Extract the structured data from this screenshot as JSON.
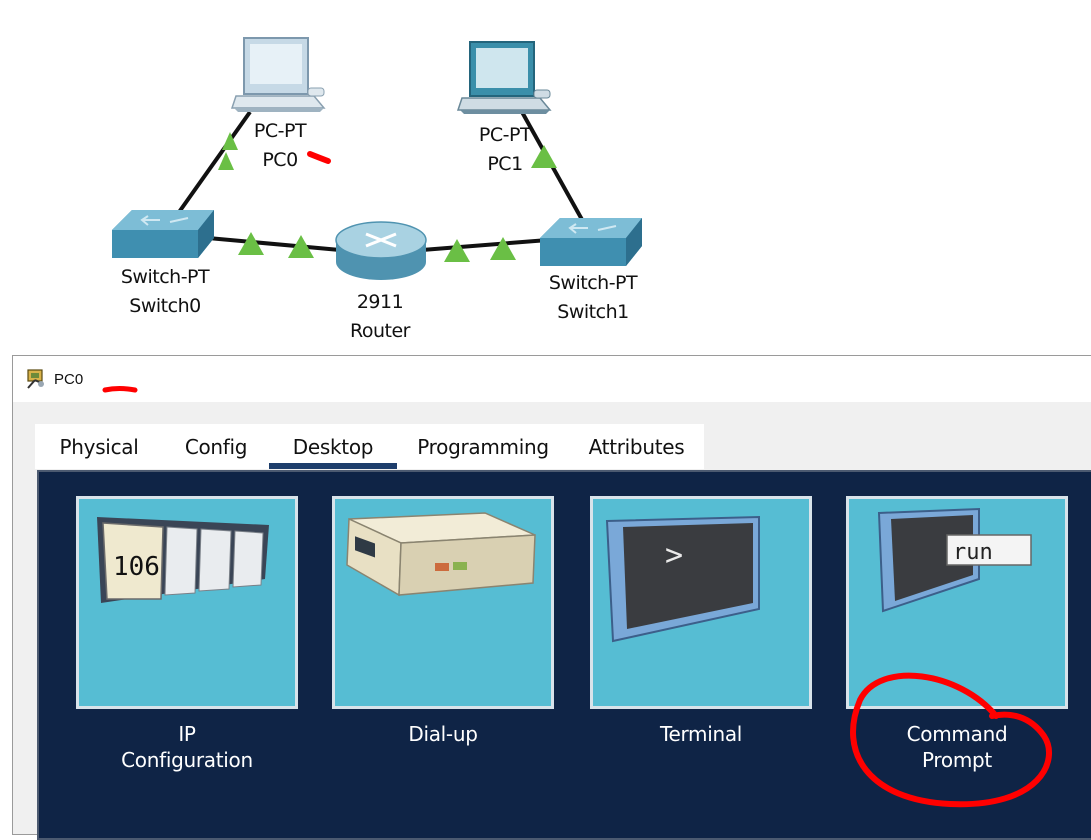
{
  "topology": {
    "pc0": {
      "model": "PC-PT",
      "name": "PC0"
    },
    "pc1": {
      "model": "PC-PT",
      "name": "PC1"
    },
    "switch0": {
      "model": "Switch-PT",
      "name": "Switch0"
    },
    "switch1": {
      "model": "Switch-PT",
      "name": "Switch1"
    },
    "router": {
      "model": "2911",
      "name": "Router"
    },
    "link_status_color": "#6abf45"
  },
  "window": {
    "title": "PC0",
    "tabs": [
      {
        "label": "Physical"
      },
      {
        "label": "Config"
      },
      {
        "label": "Desktop"
      },
      {
        "label": "Programming"
      },
      {
        "label": "Attributes"
      }
    ],
    "active_tab": "Desktop",
    "apps": [
      {
        "line1": "IP",
        "line2": "Configuration",
        "icon": "ip-configuration-icon"
      },
      {
        "line1": "Dial-up",
        "line2": "",
        "icon": "dialup-icon"
      },
      {
        "line1": "Terminal",
        "line2": "",
        "icon": "terminal-icon"
      },
      {
        "line1": "Command",
        "line2": "Prompt",
        "icon": "command-prompt-icon"
      }
    ],
    "ip_icon_text": "106",
    "terminal_icon_text": ">",
    "cmd_icon_text": "run"
  },
  "colors": {
    "desktop_bg": "#0f2446",
    "tile_bg": "#56bdd3",
    "annotation": "#ff0000"
  }
}
